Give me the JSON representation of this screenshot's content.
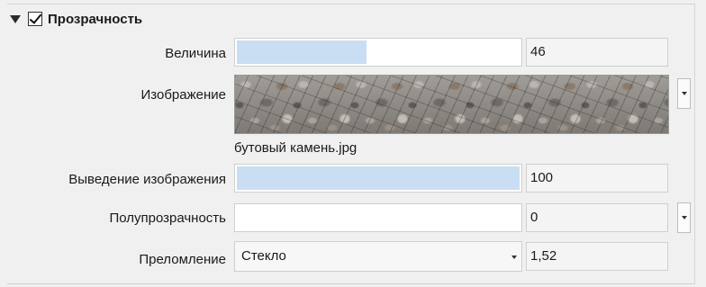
{
  "section": {
    "title": "Прозрачность",
    "enabled": true
  },
  "rows": {
    "amount": {
      "label": "Величина",
      "slider_fraction": 0.46,
      "value": "46"
    },
    "image": {
      "label": "Изображение",
      "thumbnail_icon": "stone-texture-thumbnail",
      "filename": "бутовый камень.jpg"
    },
    "image_fade": {
      "label": "Выведение изображения",
      "slider_fraction": 1.0,
      "value": "100"
    },
    "translucency": {
      "label": "Полупрозрачность",
      "slider_fraction": 0.0,
      "value": "0"
    },
    "refraction": {
      "label": "Преломление",
      "selected": "Стекло",
      "value": "1,52"
    }
  },
  "colors": {
    "slider_fill": "#c9def3",
    "panel_background": "#f0f0f0"
  }
}
